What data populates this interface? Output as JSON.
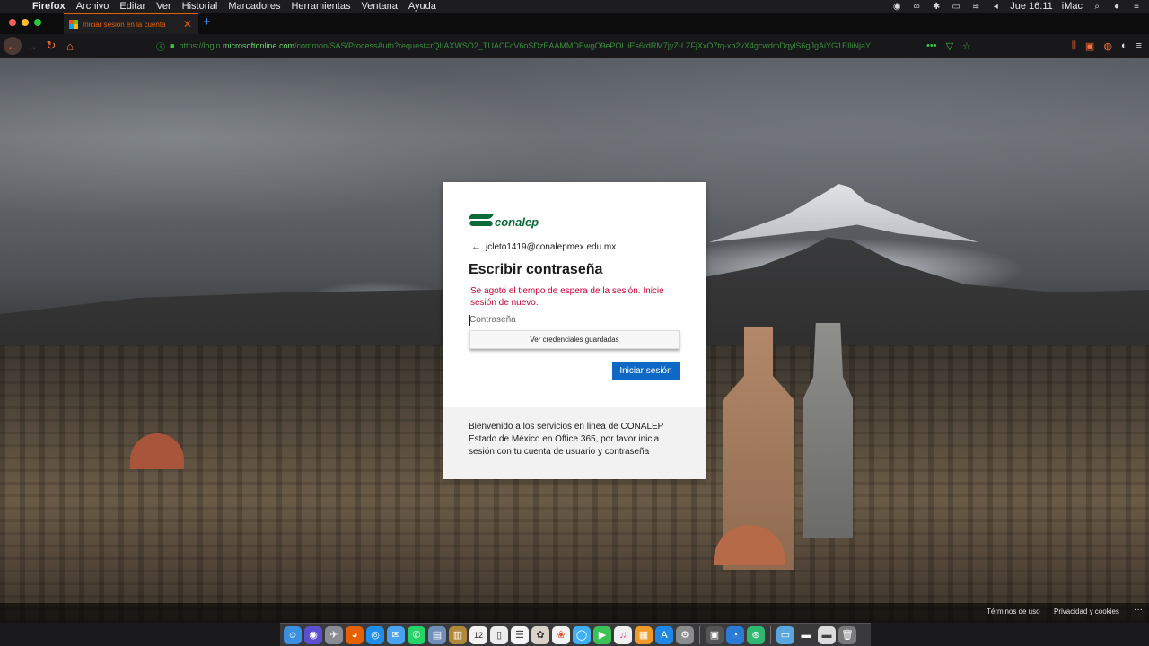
{
  "menubar": {
    "app_name": "Firefox",
    "items": [
      "Archivo",
      "Editar",
      "Ver",
      "Historial",
      "Marcadores",
      "Herramientas",
      "Ventana",
      "Ayuda"
    ],
    "clock": "Jue 16:11",
    "computer_name": "iMac"
  },
  "tab": {
    "title": "Iniciar sesión en la cuenta"
  },
  "address_bar": {
    "url_prefix": "https://login.",
    "url_domain": "microsoftonline.com",
    "url_path": "/common/SAS/ProcessAuth?request=rQIIAXWSO2_TUACFcV6oSDzEAAMMDEwgO9ePOLiiEs6rdRM7jyZ-LZFjXxO7tq-xb2vX4gcwdmDqylS6gJgAiYG1EIliNjaY"
  },
  "login": {
    "brand": "conalep",
    "account_email": "jcleto1419@conalepmex.edu.mx",
    "heading": "Escribir contraseña",
    "error_message": "Se agotó el tiempo de espera de la sesión. Inicie sesión de nuevo.",
    "password_placeholder": "Contraseña",
    "saved_credentials_label": "Ver credenciales guardadas",
    "signin_label": "Iniciar sesión",
    "welcome_text": "Bienvenido a los servicios en linea de CONALEP Estado de México en Office 365, por favor inicia sesión con tu cuenta de usuario y contraseña"
  },
  "page_footer": {
    "terms": "Términos de uso",
    "privacy": "Privacidad y cookies",
    "more": "···"
  },
  "dock": {
    "calendar_day": "12"
  },
  "colors": {
    "firefox_accent": "#e66000",
    "conalep_green": "#0b6b38",
    "signin_blue": "#0f68c4",
    "error_red": "#c4002f"
  }
}
